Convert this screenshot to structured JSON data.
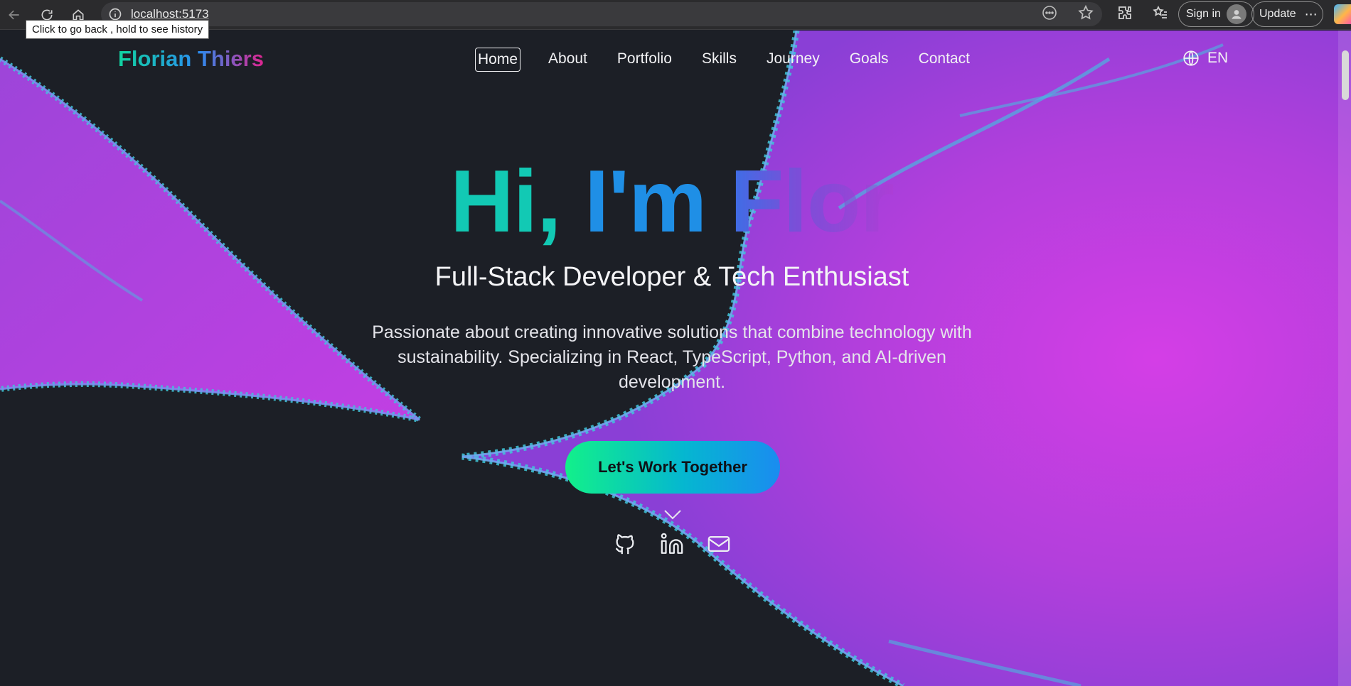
{
  "browser": {
    "url": "localhost:5173",
    "tooltip": "Click to go back , hold to see history",
    "sign_in_label": "Sign in",
    "update_label": "Update",
    "icons": {
      "back": "back-arrow-icon",
      "reload": "reload-icon",
      "home": "home-icon",
      "site_info": "info-icon",
      "reading": "more-circle-icon",
      "favorite": "star-icon",
      "extensions": "puzzle-icon",
      "collections": "favorites-list-icon",
      "more": "ellipsis-icon",
      "copilot": "copilot-icon"
    }
  },
  "site": {
    "logo": "Florian Thiers",
    "nav": [
      {
        "label": "Home",
        "active": true
      },
      {
        "label": "About",
        "active": false
      },
      {
        "label": "Portfolio",
        "active": false
      },
      {
        "label": "Skills",
        "active": false
      },
      {
        "label": "Journey",
        "active": false
      },
      {
        "label": "Goals",
        "active": false
      },
      {
        "label": "Contact",
        "active": false
      }
    ],
    "language": "EN"
  },
  "hero": {
    "title_part1": "Hi,",
    "title_part2": "I'm",
    "title_part3": "Flor",
    "subtitle": "Full-Stack Developer & Tech Enthusiast",
    "description": "Passionate about creating innovative solutions that combine technology with sustainability. Specializing in React, TypeScript, Python, and AI-driven development.",
    "cta_label": "Let's Work Together",
    "socials": [
      "github-icon",
      "linkedin-icon",
      "mail-icon"
    ]
  },
  "colors": {
    "background": "#1c1f26",
    "fractal_magenta": "#c93fe0",
    "fractal_cyan": "#2fc1d6",
    "accent_teal": "#12c9b4",
    "accent_blue": "#1f8fe6",
    "accent_pink": "#e0248f"
  }
}
